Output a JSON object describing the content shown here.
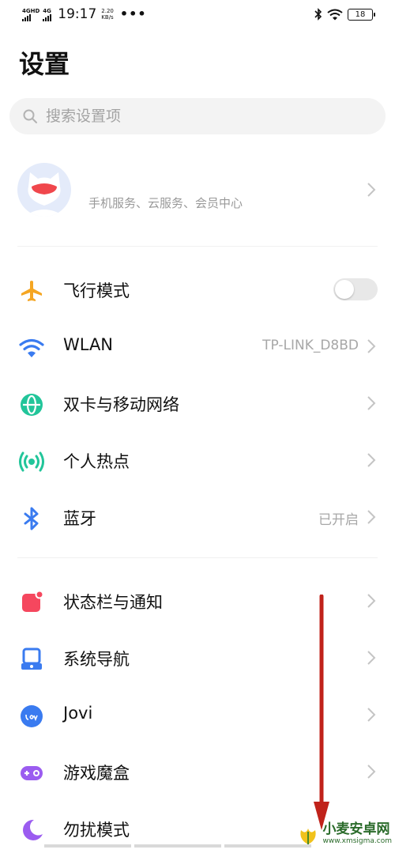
{
  "status_bar": {
    "sim1": "4GHD",
    "sim2": "4G",
    "time": "19:17",
    "speed_value": "2.20",
    "speed_unit": "KB/s",
    "more": "•••",
    "battery": "18"
  },
  "page_title": "设置",
  "search": {
    "placeholder": "搜索设置项"
  },
  "account": {
    "subtitle": "手机服务、云服务、会员中心"
  },
  "settings": [
    {
      "label": "飞行模式",
      "icon": "airplane-icon",
      "color": "#f5a623",
      "toggle": false
    },
    {
      "label": "WLAN",
      "value": "TP-LINK_D8BD",
      "icon": "wifi-icon",
      "color": "#3a7bf0"
    },
    {
      "label": "双卡与移动网络",
      "icon": "globe-icon",
      "color": "#22c59a"
    },
    {
      "label": "个人热点",
      "icon": "hotspot-icon",
      "color": "#22c59a"
    },
    {
      "label": "蓝牙",
      "value": "已开启",
      "icon": "bluetooth-icon",
      "color": "#3a7bf0"
    },
    {
      "label": "状态栏与通知",
      "icon": "notification-icon",
      "color": "#f5475e"
    },
    {
      "label": "系统导航",
      "icon": "navigation-icon",
      "color": "#3a7bf0"
    },
    {
      "label": "Jovi",
      "icon": "jovi-icon",
      "color": "#3a7bf0"
    },
    {
      "label": "游戏魔盒",
      "icon": "game-box-icon",
      "color": "#9b5cf0"
    },
    {
      "label": "勿扰模式",
      "icon": "moon-icon",
      "color": "#9b5cf0"
    }
  ],
  "watermark": {
    "title": "小麦安卓网",
    "url": "www.xmsigma.com"
  }
}
